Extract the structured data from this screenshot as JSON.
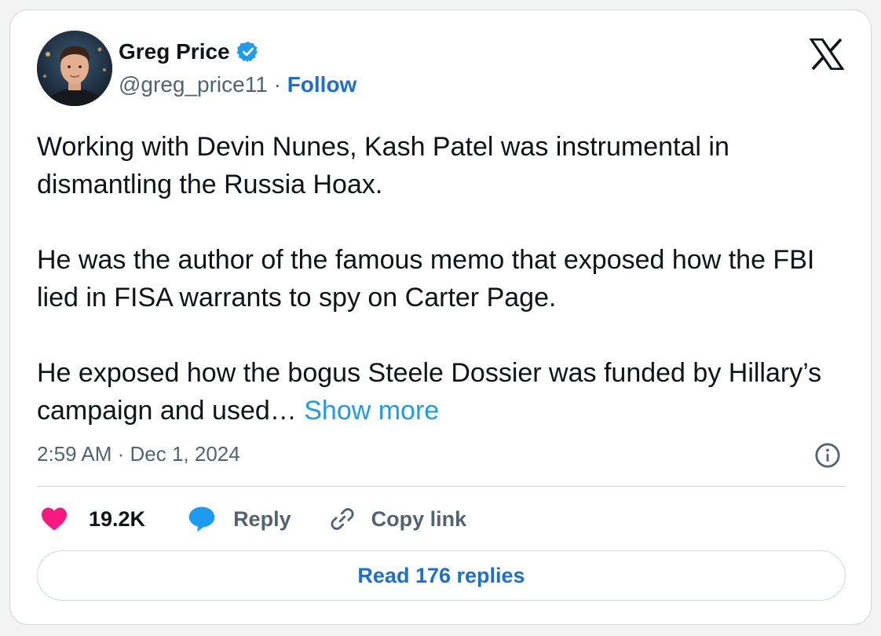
{
  "author": {
    "name": "Greg Price",
    "handle": "@greg_price11",
    "separator": " · ",
    "follow_label": "Follow",
    "verified": true
  },
  "tweet": {
    "paragraphs": [
      "Working with Devin Nunes, Kash Patel was instrumental in dismantling the Russia Hoax.",
      "He was the author of the famous memo that exposed how the FBI lied in FISA warrants to spy on Carter Page.",
      "He exposed how the bogus Steele Dossier was funded by Hillary’s campaign and used…"
    ],
    "show_more_label": "Show more",
    "timestamp": "2:59 AM · Dec 1, 2024"
  },
  "actions": {
    "likes": "19.2K",
    "reply_label": "Reply",
    "copy_link_label": "Copy link"
  },
  "read_replies_label": "Read 176 replies",
  "icons": {
    "verified": "verified-badge-icon",
    "platform": "x-logo-icon",
    "info": "info-icon",
    "like": "heart-icon",
    "reply": "speech-bubble-icon",
    "copy": "link-icon"
  },
  "colors": {
    "accent": "#1d9bf0",
    "link_dark": "#1d6fcc",
    "like": "#f91880",
    "secondary_text": "#536471",
    "border": "#cfd9de"
  }
}
